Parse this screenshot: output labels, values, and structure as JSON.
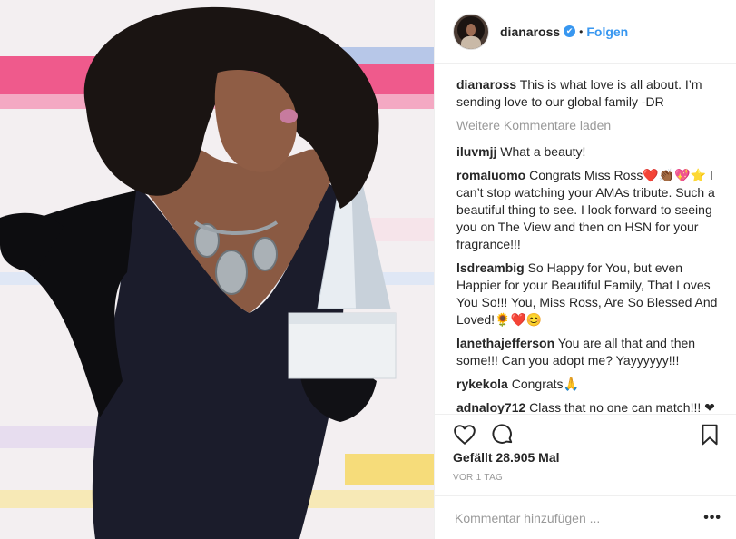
{
  "post": {
    "photo_alt": "",
    "header": {
      "username": "dianaross",
      "verified_glyph": "✔",
      "separator": "•",
      "follow_label": "Folgen"
    },
    "caption": {
      "username": "dianaross",
      "text": "This is what love is all about. I’m sending love to our global family -DR"
    },
    "load_more_label": "Weitere Kommentare laden",
    "comments": [
      {
        "username": "iluvmjj",
        "text": "What a beauty!"
      },
      {
        "username": "romaluomo",
        "text": "Congrats Miss Ross❤️👏🏾💖⭐ I can’t stop watching your AMAs tribute. Such a beautiful thing to see. I look forward to seeing you on The View and then on HSN for your fragrance!!!"
      },
      {
        "username": "lsdreambig",
        "text": "So Happy for You, but even Happier for your Beautiful Family, That Loves You So!!! You, Miss Ross, Are So Blessed And Loved!🌻❤️😊"
      },
      {
        "username": "lanethajefferson",
        "text": "You are all that and then some!!! Can you adopt me? Yayyyyyy!!!"
      },
      {
        "username": "rykekola",
        "text": "Congrats🙏"
      },
      {
        "username": "adnaloy712",
        "text": "Class that no one can match!!! ❤❤❤"
      }
    ],
    "actions": {
      "like_icon": "heart-outline-icon",
      "comment_icon": "comment-bubble-icon",
      "save_icon": "bookmark-icon"
    },
    "likes_text": "Gefällt 28.905 Mal",
    "date_text": "VOR 1 TAG",
    "composer": {
      "placeholder": "Kommentar hinzufügen ...",
      "options_label": "•••"
    }
  },
  "colors": {
    "link_blue": "#3897f0",
    "border": "#efefef",
    "muted_text": "#999999",
    "text": "#262626"
  }
}
